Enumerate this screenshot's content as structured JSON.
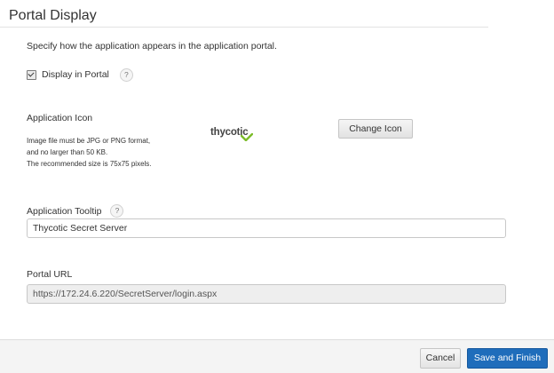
{
  "page": {
    "title": "Portal Display",
    "intro": "Specify how the application appears in the application portal."
  },
  "display_in_portal": {
    "label": "Display in Portal",
    "checked": true,
    "help": "?"
  },
  "application_icon": {
    "label": "Application Icon",
    "hint_line1": "Image file must be JPG or PNG format,",
    "hint_line2": "and no larger than 50 KB.",
    "hint_line3": "The recommended size is 75x75 pixels.",
    "logo_text": "thycotic",
    "change_button": "Change Icon"
  },
  "application_tooltip": {
    "label": "Application Tooltip",
    "help": "?",
    "value": "Thycotic Secret Server"
  },
  "portal_url": {
    "label": "Portal URL",
    "value": "https://172.24.6.220/SecretServer/login.aspx"
  },
  "footer": {
    "cancel": "Cancel",
    "save": "Save and Finish"
  },
  "colors": {
    "primary_button": "#1f6dbb",
    "logo_check": "#7cbc2a"
  }
}
